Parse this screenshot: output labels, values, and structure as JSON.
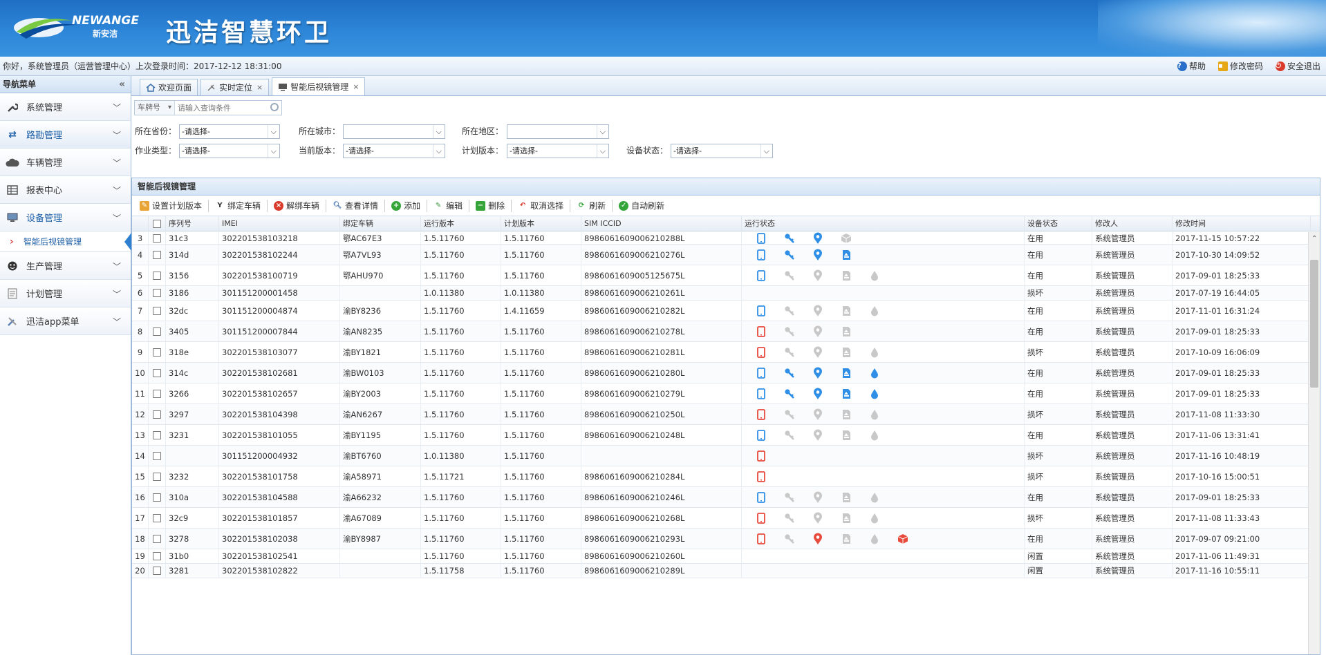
{
  "header": {
    "logo_text": "NEWANGE",
    "logo_sub": "新安洁",
    "title": "迅洁智慧环卫"
  },
  "infobar": {
    "greeting": "你好，系统管理员（运营管理中心）上次登录时间：2017-12-12 18:31:00",
    "help": "帮助",
    "change_password": "修改密码",
    "logout": "安全退出"
  },
  "sidebar": {
    "title": "导航菜单",
    "items": [
      {
        "label": "系统管理",
        "icon": "wrench-icon"
      },
      {
        "label": "路勘管理",
        "icon": "arrows-icon"
      },
      {
        "label": "车辆管理",
        "icon": "cloud-icon"
      },
      {
        "label": "报表中心",
        "icon": "table-icon"
      },
      {
        "label": "设备管理",
        "icon": "monitor-icon"
      },
      {
        "label": "生产管理",
        "icon": "smiley-icon"
      },
      {
        "label": "计划管理",
        "icon": "document-icon"
      },
      {
        "label": "迅洁app菜单",
        "icon": "tools-icon"
      }
    ],
    "subitem": "智能后视镜管理"
  },
  "tabs": [
    {
      "label": "欢迎页面"
    },
    {
      "label": "实时定位"
    },
    {
      "label": "智能后视镜管理"
    }
  ],
  "search": {
    "field": "车牌号",
    "placeholder": "请输入查询条件"
  },
  "filters": {
    "province_label": "所在省份：",
    "province_value": "-请选择-",
    "city_label": "所在城市：",
    "city_value": "",
    "area_label": "所在地区：",
    "area_value": "",
    "worktype_label": "作业类型：",
    "worktype_value": "-请选择-",
    "curver_label": "当前版本：",
    "curver_value": "-请选择-",
    "planver_label": "计划版本：",
    "planver_value": "-请选择-",
    "devstat_label": "设备状态：",
    "devstat_value": "-请选择-"
  },
  "grid": {
    "title": "智能后视镜管理",
    "toolbar": [
      "设置计划版本",
      "绑定车辆",
      "解绑车辆",
      "查看详情",
      "添加",
      "编辑",
      "删除",
      "取消选择",
      "刷新",
      "自动刷新"
    ],
    "headers": {
      "seq": "序列号",
      "imei": "IMEI",
      "car": "绑定车辆",
      "run": "运行版本",
      "plan": "计划版本",
      "sim": "SIM ICCID",
      "status": "运行状态",
      "device": "设备状态",
      "modifier": "修改人",
      "time": "修改时间"
    },
    "colors": {
      "blue": "#2f8fe6",
      "red": "#e84a3c",
      "gray": "#c8c8c8"
    },
    "rows": [
      {
        "n": "3",
        "seq": "31c3",
        "imei": "302201538103218",
        "car": "鄂AC67E3",
        "run": "1.5.11760",
        "plan": "1.5.11760",
        "sim": "898606160900621028­8L",
        "icons": [
          "phone-b",
          "key-b",
          "pin-b",
          "box-g"
        ],
        "dev": "在用",
        "mod": "系统管理员",
        "time": "2017-11-15 10:57:22"
      },
      {
        "n": "4",
        "seq": "314d",
        "imei": "302201538102244",
        "car": "鄂A7VL93",
        "run": "1.5.11760",
        "plan": "1.5.11760",
        "sim": "89860616090062102­76L",
        "icons": [
          "phone-b",
          "key-b",
          "pin-b",
          "sd-b"
        ],
        "dev": "在用",
        "mod": "系统管理员",
        "time": "2017-10-30 14:09:52"
      },
      {
        "n": "5",
        "seq": "3156",
        "imei": "302201538100719",
        "car": "鄂AHU970",
        "run": "1.5.11760",
        "plan": "1.5.11760",
        "sim": "89860616090051256­75L",
        "icons": [
          "phone-b",
          "key-g",
          "pin-g",
          "sd-g",
          "drop-g"
        ],
        "dev": "在用",
        "mod": "系统管理员",
        "time": "2017-09-01 18:25:33"
      },
      {
        "n": "6",
        "seq": "3186",
        "imei": "301151200001458",
        "car": "",
        "run": "1.0.11380",
        "plan": "1.0.11380",
        "sim": "89860616090062102­61L",
        "icons": [],
        "dev": "损坏",
        "mod": "系统管理员",
        "time": "2017-07-19 16:44:05"
      },
      {
        "n": "7",
        "seq": "32dc",
        "imei": "301151200004874",
        "car": "渝BY8236",
        "run": "1.5.11760",
        "plan": "1.4.11659",
        "sim": "89860616090062102­82L",
        "icons": [
          "phone-b",
          "key-g",
          "pin-g",
          "sd-g",
          "drop-g"
        ],
        "dev": "在用",
        "mod": "系统管理员",
        "time": "2017-11-01 16:31:24"
      },
      {
        "n": "8",
        "seq": "3405",
        "imei": "301151200007844",
        "car": "渝AN8235",
        "run": "1.5.11760",
        "plan": "1.5.11760",
        "sim": "89860616090062102­78L",
        "icons": [
          "phone-r",
          "key-g",
          "pin-g",
          "sd-g"
        ],
        "dev": "在用",
        "mod": "系统管理员",
        "time": "2017-09-01 18:25:33"
      },
      {
        "n": "9",
        "seq": "318e",
        "imei": "302201538103077",
        "car": "渝BY1821",
        "run": "1.5.11760",
        "plan": "1.5.11760",
        "sim": "89860616090062102­81L",
        "icons": [
          "phone-r",
          "key-g",
          "pin-g",
          "sd-g",
          "drop-g"
        ],
        "dev": "损坏",
        "mod": "系统管理员",
        "time": "2017-10-09 16:06:09"
      },
      {
        "n": "10",
        "seq": "314c",
        "imei": "302201538102681",
        "car": "渝BW0103",
        "run": "1.5.11760",
        "plan": "1.5.11760",
        "sim": "89860616090062102­80L",
        "icons": [
          "phone-b",
          "key-b",
          "pin-b",
          "sd-b",
          "drop-b"
        ],
        "dev": "在用",
        "mod": "系统管理员",
        "time": "2017-09-01 18:25:33"
      },
      {
        "n": "11",
        "seq": "3266",
        "imei": "302201538102657",
        "car": "渝BY2003",
        "run": "1.5.11760",
        "plan": "1.5.11760",
        "sim": "89860616090062102­79L",
        "icons": [
          "phone-b",
          "key-b",
          "pin-b",
          "sd-b",
          "drop-b"
        ],
        "dev": "在用",
        "mod": "系统管理员",
        "time": "2017-09-01 18:25:33"
      },
      {
        "n": "12",
        "seq": "3297",
        "imei": "302201538104398",
        "car": "渝AN6267",
        "run": "1.5.11760",
        "plan": "1.5.11760",
        "sim": "89860616090062102­50L",
        "icons": [
          "phone-r",
          "key-g",
          "pin-g",
          "sd-g",
          "drop-g"
        ],
        "dev": "损坏",
        "mod": "系统管理员",
        "time": "2017-11-08 11:33:30"
      },
      {
        "n": "13",
        "seq": "3231",
        "imei": "302201538101055",
        "car": "渝BY1195",
        "run": "1.5.11760",
        "plan": "1.5.11760",
        "sim": "89860616090062102­48L",
        "icons": [
          "phone-b",
          "key-g",
          "pin-g",
          "sd-g",
          "drop-g"
        ],
        "dev": "在用",
        "mod": "系统管理员",
        "time": "2017-11-06 13:31:41"
      },
      {
        "n": "14",
        "seq": "",
        "imei": "301151200004932",
        "car": "渝BT6760",
        "run": "1.0.11380",
        "plan": "1.5.11760",
        "sim": "",
        "icons": [
          "phone-r"
        ],
        "dev": "损坏",
        "mod": "系统管理员",
        "time": "2017-11-16 10:48:19"
      },
      {
        "n": "15",
        "seq": "3232",
        "imei": "302201538101758",
        "car": "渝A58971",
        "run": "1.5.11721",
        "plan": "1.5.11760",
        "sim": "89860616090062102­84L",
        "icons": [
          "phone-r"
        ],
        "dev": "损坏",
        "mod": "系统管理员",
        "time": "2017-10-16 15:00:51"
      },
      {
        "n": "16",
        "seq": "310a",
        "imei": "302201538104588",
        "car": "渝A66232",
        "run": "1.5.11760",
        "plan": "1.5.11760",
        "sim": "89860616090062102­46L",
        "icons": [
          "phone-b",
          "key-g",
          "pin-g",
          "sd-g",
          "drop-g"
        ],
        "dev": "在用",
        "mod": "系统管理员",
        "time": "2017-09-01 18:25:33"
      },
      {
        "n": "17",
        "seq": "32c9",
        "imei": "302201538101857",
        "car": "渝A67089",
        "run": "1.5.11760",
        "plan": "1.5.11760",
        "sim": "89860616090062102­68L",
        "icons": [
          "phone-r",
          "key-g",
          "pin-g",
          "sd-g",
          "drop-g"
        ],
        "dev": "损坏",
        "mod": "系统管理员",
        "time": "2017-11-08 11:33:43"
      },
      {
        "n": "18",
        "seq": "3278",
        "imei": "302201538102038",
        "car": "渝BY8987",
        "run": "1.5.11760",
        "plan": "1.5.11760",
        "sim": "89860616090062102­93L",
        "icons": [
          "phone-r",
          "key-g",
          "pin-r",
          "sd-g",
          "drop-g",
          "box-r"
        ],
        "dev": "在用",
        "mod": "系统管理员",
        "time": "2017-09-07 09:21:00"
      },
      {
        "n": "19",
        "seq": "31b0",
        "imei": "302201538102541",
        "car": "",
        "run": "1.5.11760",
        "plan": "1.5.11760",
        "sim": "89860616090062102­60L",
        "icons": [],
        "dev": "闲置",
        "mod": "系统管理员",
        "time": "2017-11-06 11:49:31"
      },
      {
        "n": "20",
        "seq": "3281",
        "imei": "302201538102822",
        "car": "",
        "run": "1.5.11758",
        "plan": "1.5.11760",
        "sim": "89860616090062102­89L",
        "icons": [],
        "dev": "闲置",
        "mod": "系统管理员",
        "time": "2017-11-16 10:55:11"
      }
    ]
  }
}
